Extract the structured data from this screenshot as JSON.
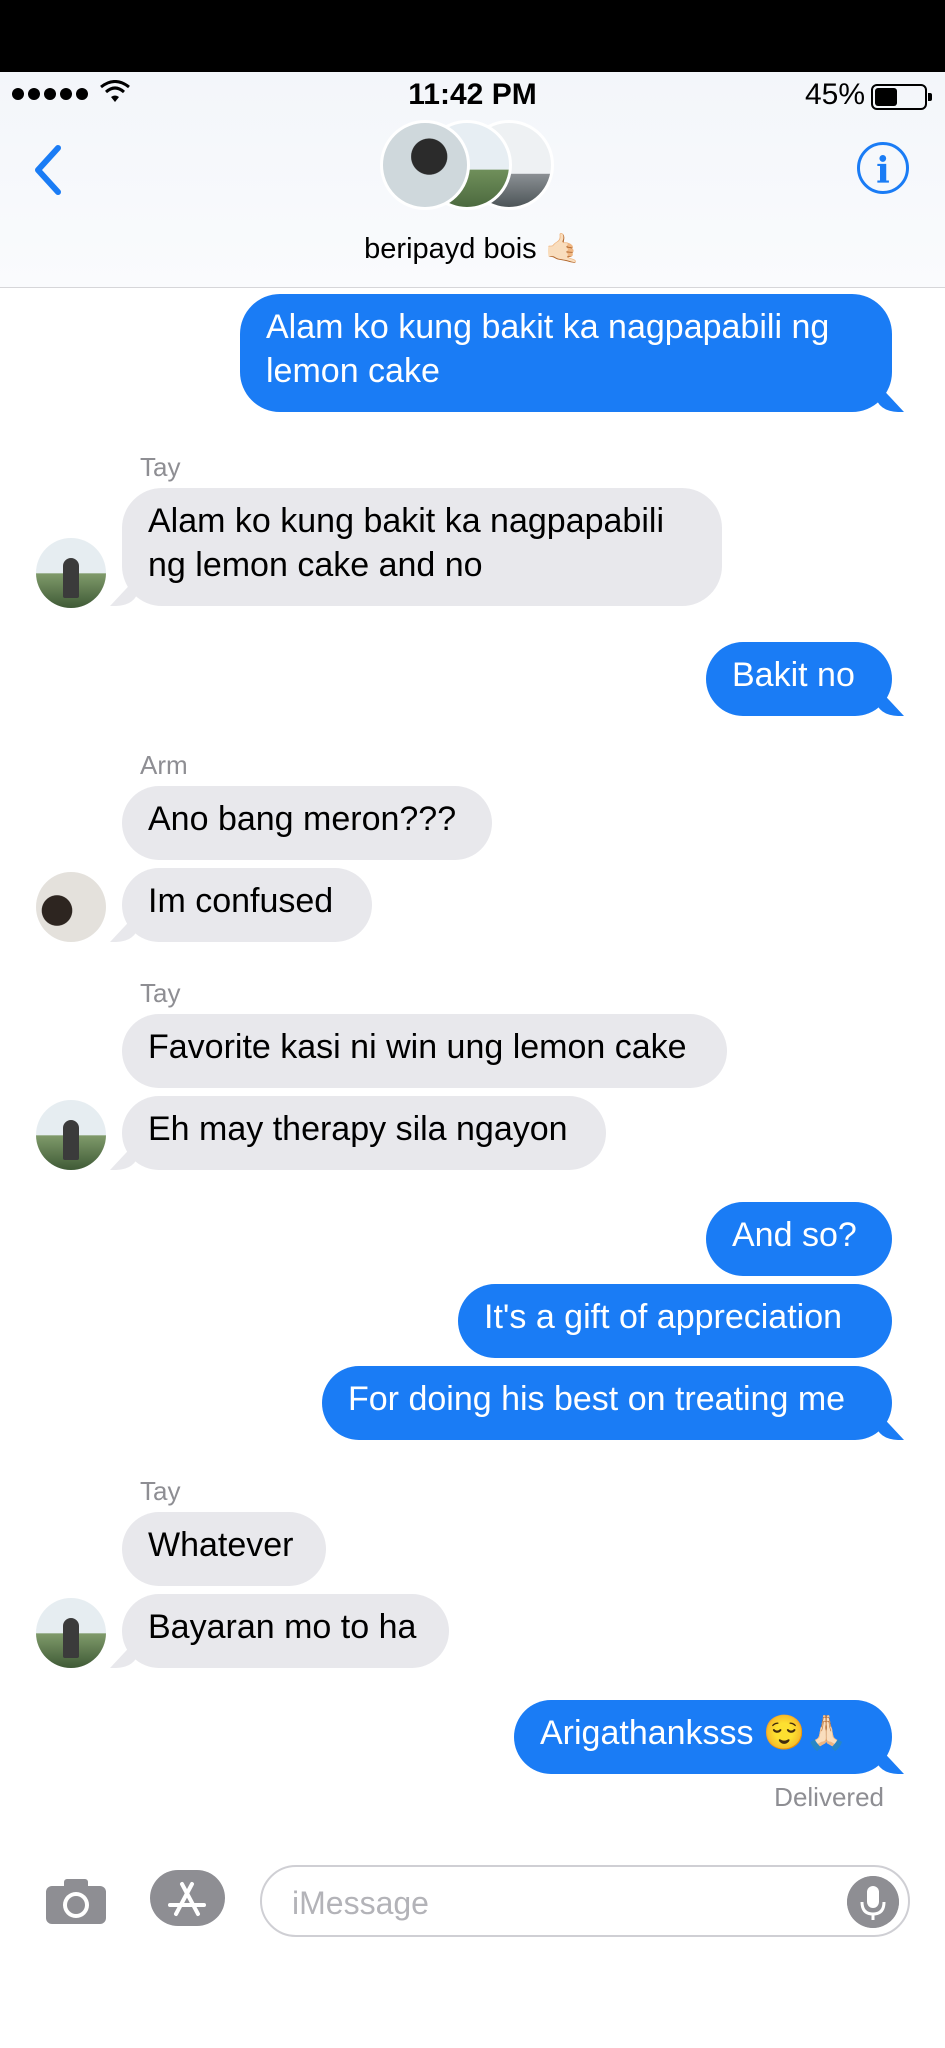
{
  "status": {
    "time": "11:42 PM",
    "battery": "45%"
  },
  "header": {
    "group_name": "beripayd bois 🤙🏻"
  },
  "messages": [
    {
      "from": "me",
      "text": "Alam ko kung bakit ka nagpapabili ng lemon cake"
    },
    {
      "from": "Tay",
      "text": "Alam ko kung bakit ka nagpapabili ng lemon cake and no"
    },
    {
      "from": "me",
      "text": "Bakit no"
    },
    {
      "from": "Arm",
      "text": "Ano bang meron???"
    },
    {
      "from": "Arm",
      "text": "Im confused"
    },
    {
      "from": "Tay",
      "text": "Favorite kasi ni win ung lemon cake"
    },
    {
      "from": "Tay",
      "text": "Eh may therapy sila ngayon"
    },
    {
      "from": "me",
      "text": "And so?"
    },
    {
      "from": "me",
      "text": "It's a gift of appreciation"
    },
    {
      "from": "me",
      "text": "For doing his best on treating me"
    },
    {
      "from": "Tay",
      "text": "Whatever"
    },
    {
      "from": "Tay",
      "text": "Bayaran mo to ha"
    },
    {
      "from": "me",
      "text": "Arigathanksss 😌🙏🏻"
    }
  ],
  "senders": {
    "tay": "Tay",
    "arm": "Arm"
  },
  "delivery_status": "Delivered",
  "composer": {
    "placeholder": "iMessage"
  },
  "icons": [
    "back-chevron-icon",
    "info-icon",
    "camera-icon",
    "app-store-icon",
    "microphone-icon",
    "wifi-icon",
    "battery-icon"
  ],
  "colors": {
    "accent": "#1a7cf5",
    "incoming_bubble": "#e8e8ec",
    "secondary_text": "#8e8e93"
  }
}
